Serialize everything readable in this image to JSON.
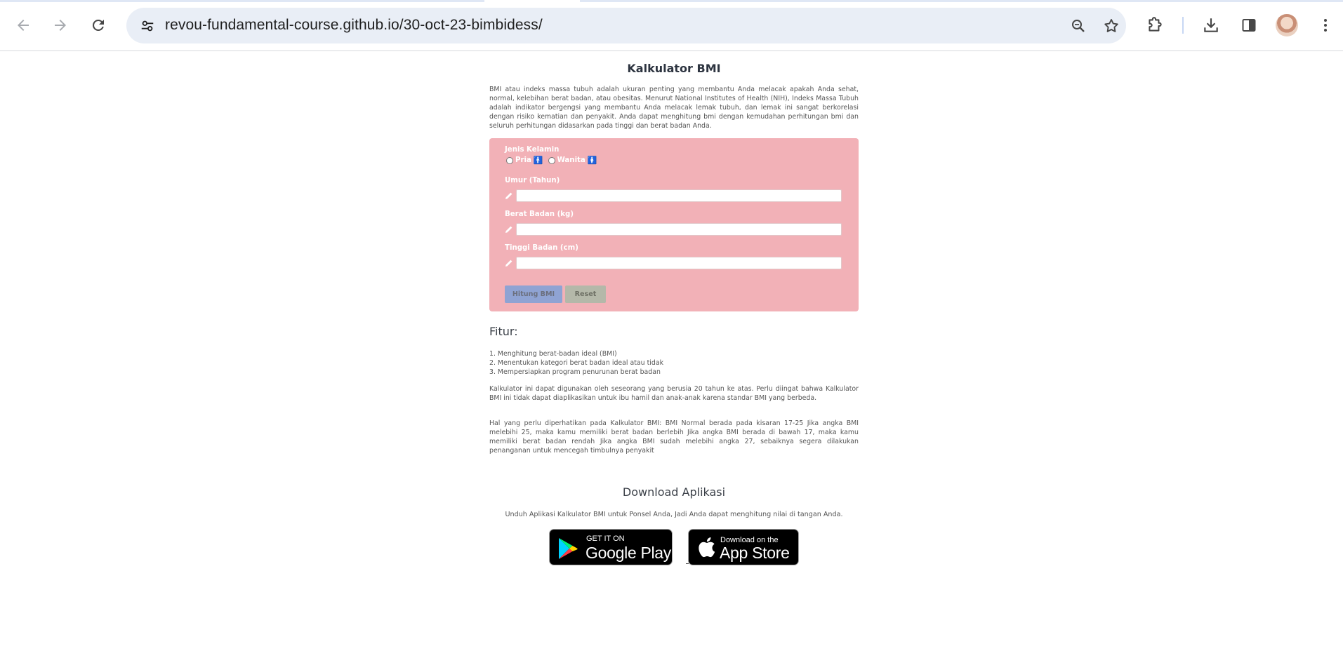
{
  "browser": {
    "url": "revou-fundamental-course.github.io/30-oct-23-bimbidess/",
    "icons": [
      "back-arrow-icon",
      "forward-arrow-icon",
      "reload-icon",
      "site-info-icon",
      "zoom-icon",
      "bookmark-star-icon",
      "extensions-icon",
      "download-icon",
      "side-panel-icon",
      "profile-avatar",
      "more-menu-icon"
    ]
  },
  "page": {
    "title": "Kalkulator BMI",
    "intro": "BMI atau indeks massa tubuh adalah ukuran penting yang membantu Anda melacak apakah Anda sehat, normal, kelebihan berat badan, atau obesitas. Menurut National Institutes of Health (NIH), Indeks Massa Tubuh adalah indikator bergengsi yang membantu Anda melacak lemak tubuh, dan lemak ini sangat berkorelasi dengan risiko kematian dan penyakit. Anda dapat menghitung bmi dengan kemudahan perhitungan bmi dan seluruh perhitungan didasarkan pada tinggi dan berat badan Anda.",
    "form": {
      "gender_label": "Jenis Kelamin",
      "male_label": "Pria",
      "male_symbol": "🚹",
      "female_label": "Wanita",
      "female_symbol": "🚺",
      "age_label": "Umur (Tahun)",
      "age_value": "",
      "weight_label": "Berat Badan (kg)",
      "weight_value": "",
      "height_label": "Tinggi Badan (cm)",
      "height_value": "",
      "calculate_button": "Hitung BMI",
      "reset_button": "Reset",
      "colors": {
        "form_bg": "#f2b1b7",
        "calculate_bg": "#8fa3d3",
        "reset_bg": "#b4b8a9"
      }
    },
    "features": {
      "title": "Fitur:",
      "items": [
        "1. Menghitung berat-badan ideal (BMI)",
        "2. Menentukan kategori berat badan ideal atau tidak",
        "3. Mempersiapkan program penurunan berat badan"
      ],
      "paragraph1": "Kalkulator ini dapat digunakan oleh seseorang yang berusia 20 tahun ke atas. Perlu diingat bahwa Kalkulator BMI ini tidak dapat diaplikasikan untuk ibu hamil dan anak-anak karena standar BMI yang berbeda.",
      "paragraph2": "Hal yang perlu diperhatikan pada Kalkulator BMI: BMI Normal berada pada kisaran 17-25 Jika angka BMI melebihi 25, maka kamu memiliki berat badan berlebih Jika angka BMI berada di bawah 17, maka kamu memiliki berat badan rendah Jika angka BMI sudah melebihi angka 27, sebaiknya segera dilakukan penanganan untuk mencegah timbulnya penyakit"
    },
    "download": {
      "title": "Download Aplikasi",
      "subtitle": "Unduh Aplikasi Kalkulator BMI untuk Ponsel Anda, Jadi Anda dapat menghitung nilai di tangan Anda.",
      "google_play_small": "GET IT ON",
      "google_play_big": "Google Play",
      "app_store_small": "Download on the",
      "app_store_big": "App Store"
    }
  }
}
